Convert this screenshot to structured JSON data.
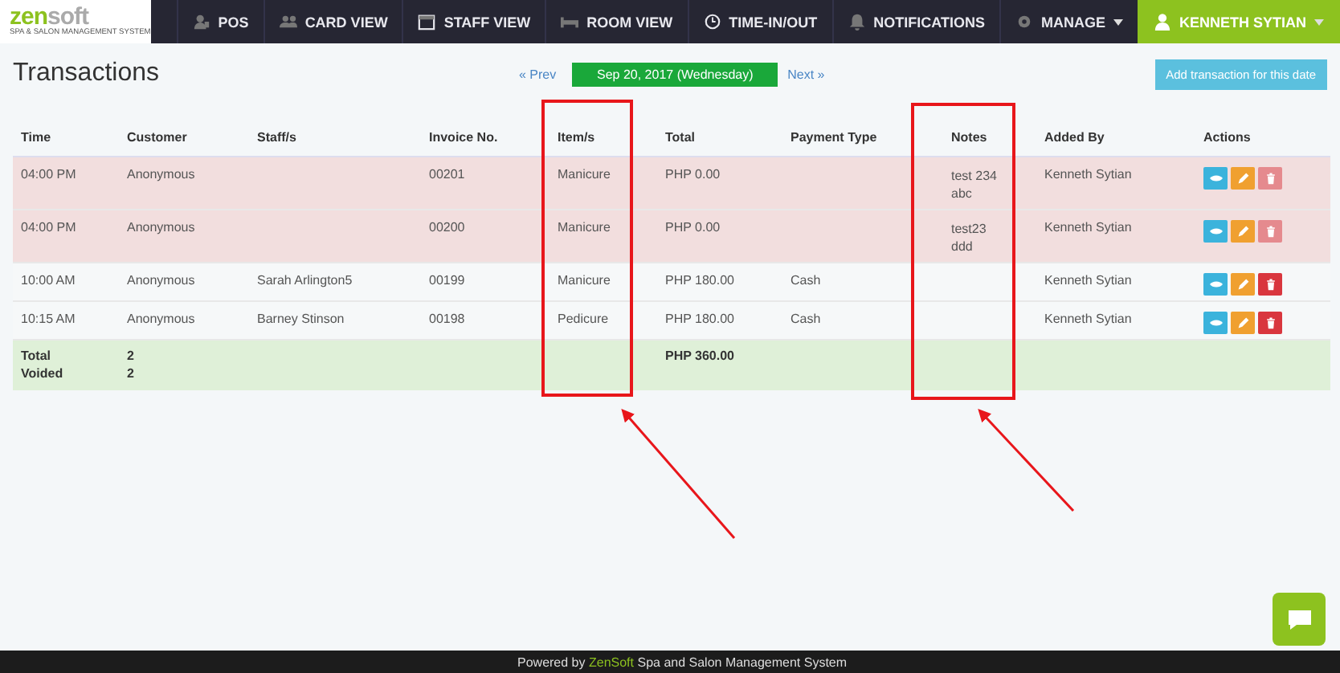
{
  "logo": {
    "brand_first": "zen",
    "brand_second": "soft",
    "tagline": "SPA & SALON MANAGEMENT SYSTEM"
  },
  "nav": [
    {
      "label": "POS",
      "dropdown": false
    },
    {
      "label": "CARD VIEW",
      "dropdown": false
    },
    {
      "label": "STAFF VIEW",
      "dropdown": false
    },
    {
      "label": "ROOM VIEW",
      "dropdown": false
    },
    {
      "label": "TIME-IN/OUT",
      "dropdown": false
    },
    {
      "label": "NOTIFICATIONS",
      "dropdown": false
    },
    {
      "label": "MANAGE",
      "dropdown": true
    }
  ],
  "user_menu": {
    "label": "KENNETH SYTIAN",
    "dropdown": true
  },
  "page_title": "Transactions",
  "date_nav": {
    "prev": "« Prev",
    "date": "Sep 20, 2017 (Wednesday)",
    "next": "Next »"
  },
  "add_button": "Add transaction for this date",
  "table": {
    "columns": [
      "Time",
      "Customer",
      "Staff/s",
      "Invoice No.",
      "Item/s",
      "Total",
      "Payment Type",
      "Notes",
      "Added By",
      "Actions"
    ],
    "rows": [
      {
        "time": "04:00 PM",
        "customer": "Anonymous",
        "staff": "",
        "invoice": "00201",
        "items": "Manicure",
        "total": "PHP 0.00",
        "payment": "",
        "notes": [
          "test 234",
          "abc"
        ],
        "added_by": "Kenneth Sytian",
        "voided": true
      },
      {
        "time": "04:00 PM",
        "customer": "Anonymous",
        "staff": "",
        "invoice": "00200",
        "items": "Manicure",
        "total": "PHP 0.00",
        "payment": "",
        "notes": [
          "test23",
          "ddd"
        ],
        "added_by": "Kenneth Sytian",
        "voided": true
      },
      {
        "time": "10:00 AM",
        "customer": "Anonymous",
        "staff": "Sarah Arlington5",
        "invoice": "00199",
        "items": "Manicure",
        "total": "PHP 180.00",
        "payment": "Cash",
        "notes": [],
        "added_by": "Kenneth Sytian",
        "voided": false
      },
      {
        "time": "10:15 AM",
        "customer": "Anonymous",
        "staff": "Barney Stinson",
        "invoice": "00198",
        "items": "Pedicure",
        "total": "PHP 180.00",
        "payment": "Cash",
        "notes": [],
        "added_by": "Kenneth Sytian",
        "voided": false
      }
    ],
    "summary": {
      "total_label": "Total",
      "total_count": "2",
      "voided_label": "Voided",
      "voided_count": "2",
      "total_amount": "PHP 360.00"
    }
  },
  "footer": {
    "prefix": "Powered by",
    "brand": "ZenSoft",
    "suffix": "Spa and Salon Management System"
  }
}
